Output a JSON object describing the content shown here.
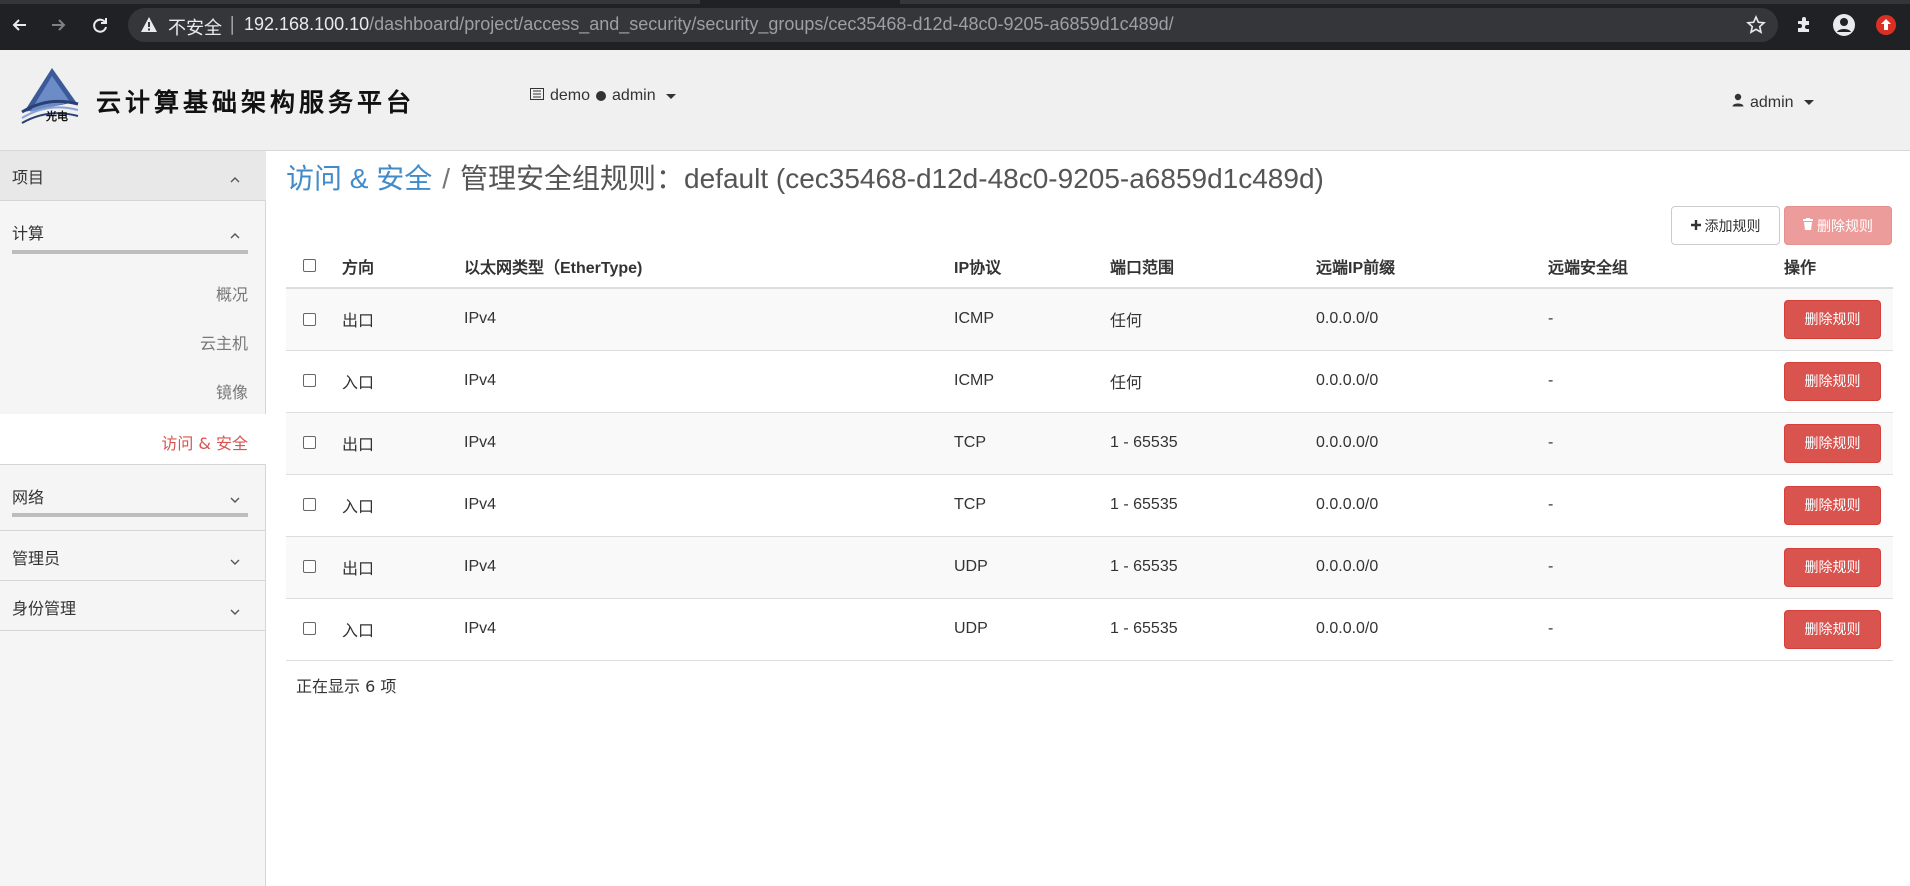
{
  "browser": {
    "security_label": "不安全",
    "url_host": "192.168.100.10",
    "url_path": "/dashboard/project/access_and_security/security_groups/cec35468-d12d-48c0-9205-a6859d1c489d/"
  },
  "header": {
    "brand": "云计算基础架构服务平台",
    "logo_text": "光电",
    "project": "demo",
    "project_user": "admin",
    "user": "admin"
  },
  "sidebar": {
    "panels": [
      {
        "label": "项目",
        "expanded": true
      },
      {
        "label": "计算",
        "expanded": true,
        "items": [
          {
            "label": "概况"
          },
          {
            "label": "云主机"
          },
          {
            "label": "镜像"
          },
          {
            "label": "访问 & 安全",
            "active": true
          }
        ]
      },
      {
        "label": "网络",
        "expanded": false
      },
      {
        "label": "管理员",
        "expanded": false
      },
      {
        "label": "身份管理",
        "expanded": false
      }
    ]
  },
  "main": {
    "breadcrumb_link": "访问 & 安全",
    "breadcrumb_sep": "/",
    "page_title": "管理安全组规则：default (cec35468-d12d-48c0-9205-a6859d1c489d)",
    "add_rule_label": "添加规则",
    "delete_rules_label": "删除规则",
    "columns": [
      "方向",
      "以太网类型（EtherType)",
      "IP协议",
      "端口范围",
      "远端IP前缀",
      "远端安全组",
      "操作"
    ],
    "rows": [
      {
        "direction": "出口",
        "ethertype": "IPv4",
        "protocol": "ICMP",
        "port_range": "任何",
        "remote_ip": "0.0.0.0/0",
        "remote_group": "-",
        "action": "删除规则"
      },
      {
        "direction": "入口",
        "ethertype": "IPv4",
        "protocol": "ICMP",
        "port_range": "任何",
        "remote_ip": "0.0.0.0/0",
        "remote_group": "-",
        "action": "删除规则"
      },
      {
        "direction": "出口",
        "ethertype": "IPv4",
        "protocol": "TCP",
        "port_range": "1 - 65535",
        "remote_ip": "0.0.0.0/0",
        "remote_group": "-",
        "action": "删除规则"
      },
      {
        "direction": "入口",
        "ethertype": "IPv4",
        "protocol": "TCP",
        "port_range": "1 - 65535",
        "remote_ip": "0.0.0.0/0",
        "remote_group": "-",
        "action": "删除规则"
      },
      {
        "direction": "出口",
        "ethertype": "IPv4",
        "protocol": "UDP",
        "port_range": "1 - 65535",
        "remote_ip": "0.0.0.0/0",
        "remote_group": "-",
        "action": "删除规则"
      },
      {
        "direction": "入口",
        "ethertype": "IPv4",
        "protocol": "UDP",
        "port_range": "1 - 65535",
        "remote_ip": "0.0.0.0/0",
        "remote_group": "-",
        "action": "删除规则"
      }
    ],
    "footer": "正在显示 6 项"
  },
  "colors": {
    "link_blue": "#428bca",
    "danger_red": "#d9534f",
    "active_item_red": "#d9534f"
  }
}
